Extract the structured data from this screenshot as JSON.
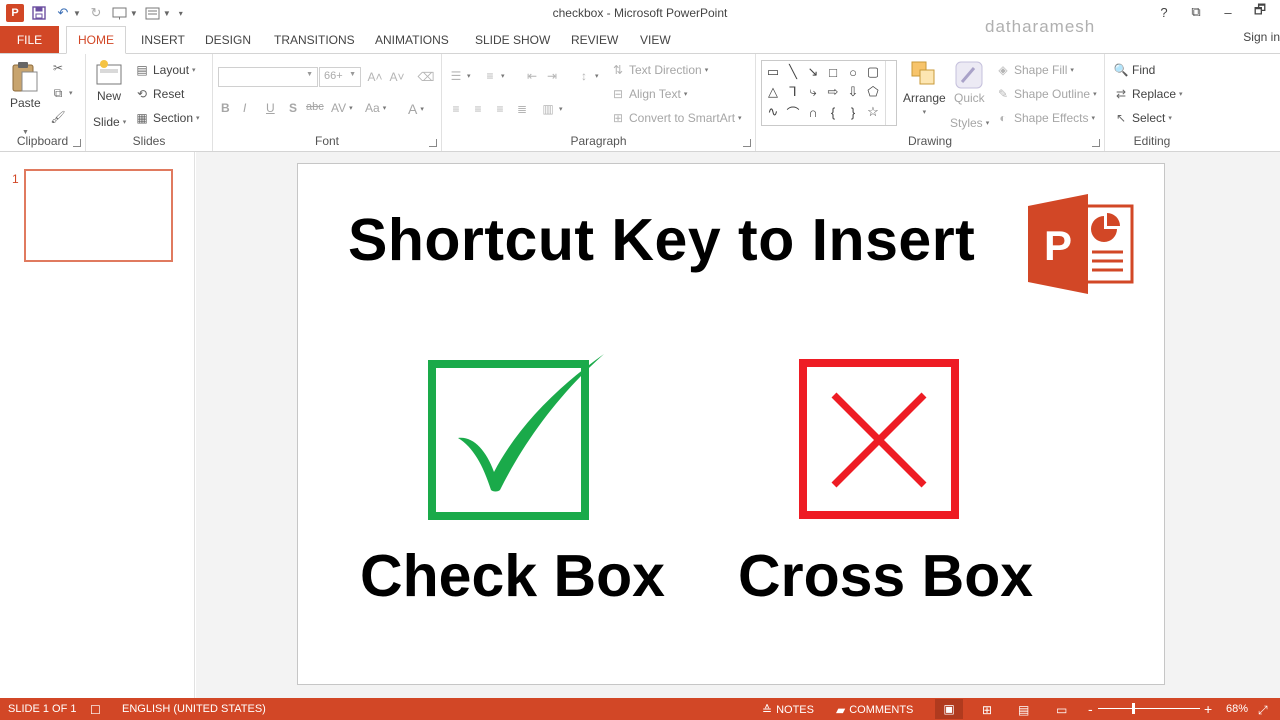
{
  "window": {
    "title": "checkbox - Microsoft PowerPoint",
    "controls": [
      "?",
      "⧉",
      "–",
      "🗗"
    ],
    "user": "datharamesh",
    "sign_in": "Sign in"
  },
  "qat": {
    "app_icon": "P"
  },
  "tabs": {
    "file": "FILE",
    "items": [
      "HOME",
      "INSERT",
      "DESIGN",
      "TRANSITIONS",
      "ANIMATIONS",
      "SLIDE SHOW",
      "REVIEW",
      "VIEW"
    ],
    "active": "HOME"
  },
  "ribbon": {
    "clipboard": {
      "label": "Clipboard",
      "paste": "Paste"
    },
    "slides": {
      "label": "Slides",
      "new_slide_1": "New",
      "new_slide_2": "Slide",
      "layout": "Layout",
      "reset": "Reset",
      "section": "Section"
    },
    "font": {
      "label": "Font",
      "size_placeholder": "66+",
      "bold": "B",
      "italic": "I",
      "underline": "U",
      "shadow": "S",
      "strike": "abc",
      "spacing": "AV",
      "case": "Aa",
      "color": "A"
    },
    "paragraph": {
      "label": "Paragraph",
      "text_direction": "Text Direction",
      "align_text": "Align Text",
      "convert_smartart": "Convert to SmartArt"
    },
    "drawing": {
      "label": "Drawing",
      "arrange": "Arrange",
      "quick_1": "Quick",
      "quick_2": "Styles",
      "shape_fill": "Shape Fill",
      "shape_outline": "Shape Outline",
      "shape_effects": "Shape Effects"
    },
    "editing": {
      "label": "Editing",
      "find": "Find",
      "replace": "Replace",
      "select": "Select"
    }
  },
  "thumbnails": {
    "slide_number": "1"
  },
  "slide": {
    "title": "Shortcut Key to Insert",
    "logo_letter": "P",
    "check_label": "Check Box",
    "cross_label": "Cross Box",
    "colors": {
      "check": "#1aaa4a",
      "cross": "#ee1c24",
      "logo": "#d24726"
    }
  },
  "status": {
    "slide_counter": "SLIDE 1 OF 1",
    "language": "ENGLISH (UNITED STATES)",
    "notes": "NOTES",
    "comments": "COMMENTS",
    "zoom_minus": "-",
    "zoom_plus": "+",
    "zoom_percent": "68%",
    "zoom_level": 0.68,
    "accent": "#d24726"
  }
}
